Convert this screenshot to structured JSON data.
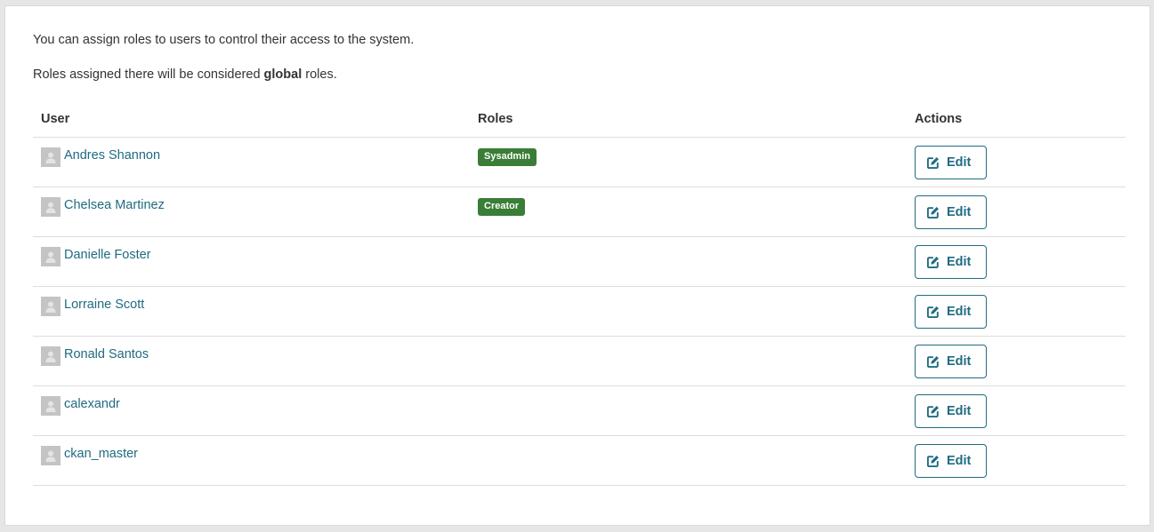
{
  "intro": {
    "line1": "You can assign roles to users to control their access to the system.",
    "line2_prefix": "Roles assigned there will be considered ",
    "line2_bold": "global",
    "line2_suffix": " roles."
  },
  "table": {
    "headers": {
      "user": "User",
      "roles": "Roles",
      "actions": "Actions"
    },
    "edit_label": "Edit",
    "rows": [
      {
        "name": "Andres Shannon",
        "role": "Sysadmin"
      },
      {
        "name": "Chelsea Martinez",
        "role": "Creator"
      },
      {
        "name": "Danielle Foster",
        "role": ""
      },
      {
        "name": "Lorraine Scott",
        "role": ""
      },
      {
        "name": "Ronald Santos",
        "role": ""
      },
      {
        "name": "calexandr",
        "role": ""
      },
      {
        "name": "ckan_master",
        "role": ""
      }
    ]
  },
  "colors": {
    "link": "#206b82",
    "role_badge": "#3a7d36",
    "avatar_bg": "#c4c4c4"
  },
  "icons": {
    "avatar": "user-silhouette-icon",
    "edit": "pencil-square-icon"
  }
}
